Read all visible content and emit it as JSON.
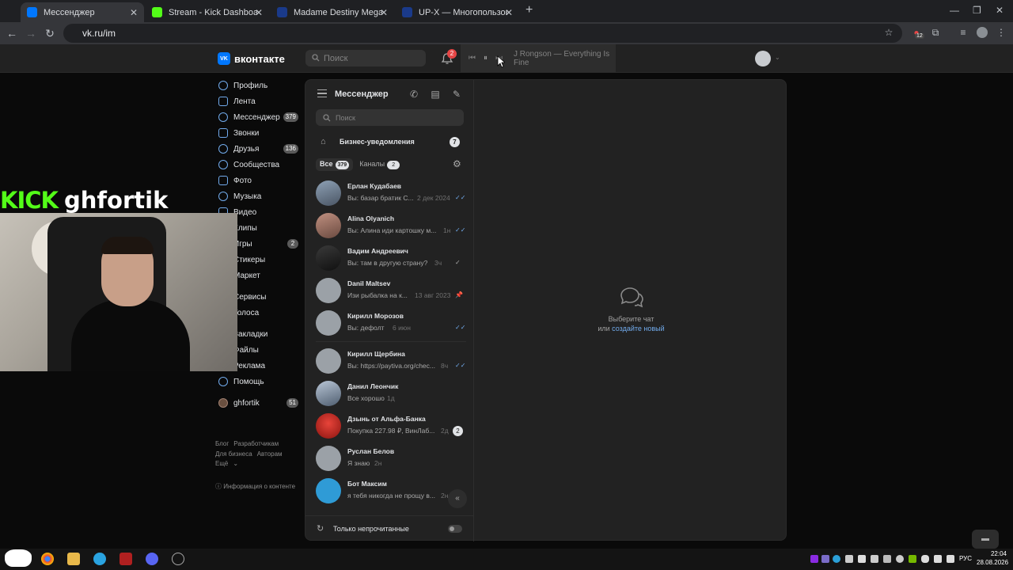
{
  "browser": {
    "tabs": [
      {
        "title": "Мессенджер",
        "color": "#0077ff",
        "active": true
      },
      {
        "title": "Stream - Kick Dashboard",
        "color": "#53fc18",
        "active": false
      },
      {
        "title": "Madame Destiny Megaways",
        "color": "#1a3a8a",
        "active": false
      },
      {
        "title": "UP-X — Многопользователь",
        "color": "#1a3a8a",
        "active": false
      }
    ],
    "url": "vk.ru/im",
    "extension_badge": "12"
  },
  "vk": {
    "logo": "вконтакте",
    "search_placeholder": "Поиск",
    "notifications_badge": "2",
    "player_track": "J Rongson — Everything Is Fine"
  },
  "left_menu": [
    {
      "label": "Профиль",
      "count": ""
    },
    {
      "label": "Лента",
      "count": ""
    },
    {
      "label": "Мессенджер",
      "count": "379"
    },
    {
      "label": "Звонки",
      "count": ""
    },
    {
      "label": "Друзья",
      "count": "136"
    },
    {
      "label": "Сообщества",
      "count": ""
    },
    {
      "label": "Фото",
      "count": ""
    },
    {
      "label": "Музыка",
      "count": ""
    },
    {
      "label": "Видео",
      "count": ""
    },
    {
      "label": "Клипы",
      "count": ""
    },
    {
      "label": "Игры",
      "count": "2"
    },
    {
      "label": "Стикеры",
      "count": ""
    },
    {
      "label": "Маркет",
      "count": ""
    },
    {
      "label": "Сервисы",
      "count": ""
    },
    {
      "label": "Голоса",
      "count": ""
    },
    {
      "label": "Закладки",
      "count": ""
    },
    {
      "label": "Файлы",
      "count": ""
    },
    {
      "label": "Реклама",
      "count": ""
    },
    {
      "label": "Помощь",
      "count": ""
    },
    {
      "label": "ghfortik",
      "count": "51"
    }
  ],
  "footer": {
    "links": [
      "Блог",
      "Разработчикам",
      "Для бизнеса",
      "Авторам",
      "Ещё"
    ],
    "info": "Информация о контенте"
  },
  "stream_overlay": {
    "brand": "KICK",
    "channel": "ghfortik"
  },
  "messenger": {
    "title": "Мессенджер",
    "search_placeholder": "Поиск",
    "business_label": "Бизнес-уведомления",
    "business_count": "7",
    "filter_all": "Все",
    "filter_all_count": "379",
    "filter_channels": "Каналы",
    "filter_channels_count": "2",
    "chats": [
      {
        "name": "Ерлан Кудабаев",
        "preview": "Вы: базар братик С...",
        "time": "2 дек 2024",
        "mark": "✓✓",
        "unread": ""
      },
      {
        "name": "Alina Olyanich",
        "preview": "Вы: Алина иди картошку м...",
        "time": "1н",
        "mark": "✓✓",
        "unread": ""
      },
      {
        "name": "Вадим Андреевич",
        "preview": "Вы: там в другую страну?",
        "time": "3ч",
        "mark": "✓",
        "unread": ""
      },
      {
        "name": "Danil Maltsev",
        "preview": "Изи рыбалка на к...",
        "time": "13 авг 2023",
        "mark": "📌",
        "unread": ""
      },
      {
        "name": "Кирилл Морозов",
        "preview": "Вы: дефолт",
        "time": "6 июн",
        "mark": "✓✓",
        "unread": ""
      },
      {
        "name": "Кирилл Щербина",
        "preview": "Вы: https://paytiva.org/chec...",
        "time": "8ч",
        "mark": "✓✓",
        "unread": ""
      },
      {
        "name": "Данил Леончик",
        "preview": "Все хорошо",
        "time": "1д",
        "mark": "",
        "unread": ""
      },
      {
        "name": "Дзынь от Альфа-Банка",
        "preview": "Покупка 227.98 ₽, ВинЛаб...",
        "time": "2д",
        "mark": "",
        "unread": "2"
      },
      {
        "name": "Руслан Белов",
        "preview": "Я знаю",
        "time": "2н",
        "mark": "",
        "unread": ""
      },
      {
        "name": "Бот Максим",
        "preview": "я тебя никогда не прощу в...",
        "time": "2н",
        "mark": "",
        "unread": ""
      }
    ],
    "unread_only_label": "Только непрочитанные",
    "empty_line1": "Выберите чат",
    "empty_or": "или",
    "empty_link": "создайте новый"
  },
  "taskbar": {
    "lang": "РУС",
    "time": "22:04",
    "date": "28.08.2026"
  }
}
